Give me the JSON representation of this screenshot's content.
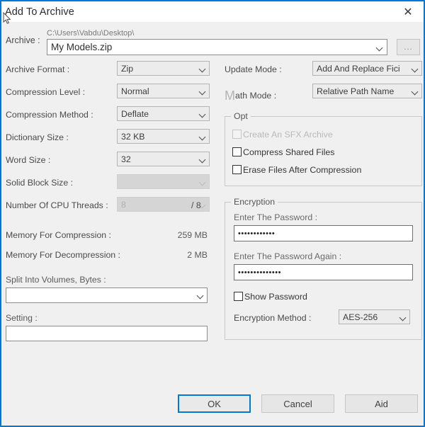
{
  "window": {
    "title": "Add To Archive",
    "close_icon": "close-icon",
    "accent_color": "#0078d7"
  },
  "archive": {
    "label": "Archive :",
    "path": "C:\\Users\\Vabdu\\Desktop\\",
    "value": "My Models.zip",
    "browse_label": "...",
    "chevron_icon": "chevron-down-icon"
  },
  "left": {
    "archive_format": {
      "label": "Archive Format :",
      "value": "Zip"
    },
    "compression_level": {
      "label": "Compression Level :",
      "value": "Normal"
    },
    "compression_method": {
      "label": "Compression Method :",
      "value": "Deflate"
    },
    "dictionary_size": {
      "label": "Dictionary Size :",
      "value": "32 KB"
    },
    "word_size": {
      "label": "Word Size :",
      "value": "32"
    },
    "solid_block_size": {
      "label": "Solid Block Size :",
      "value": ""
    },
    "cpu_threads": {
      "label": "Number Of CPU Threads :",
      "value": "8",
      "total": "/ 8"
    },
    "memory_compression": {
      "label": "Memory For Compression :",
      "value": "259 MB"
    },
    "memory_decompression": {
      "label": "Memory For Decompression :",
      "value": "2 MB"
    },
    "split_volumes": {
      "label": "Split Into Volumes, Bytes :",
      "value": ""
    },
    "setting": {
      "label": "Setting :",
      "value": ""
    }
  },
  "right": {
    "update_mode": {
      "label": "Update Mode :",
      "value": "Add And Replace Fici"
    },
    "path_mode": {
      "label_cap": "M",
      "label_rest": "ath Mode :",
      "value": "Relative Path Name"
    },
    "options": {
      "title": "Opt",
      "items": [
        {
          "label": "Create An SFX Archive",
          "checked": false,
          "disabled": true
        },
        {
          "label": "Compress Shared Files",
          "checked": false,
          "disabled": false
        },
        {
          "label": "Erase Files After Compression",
          "checked": false,
          "disabled": false
        }
      ]
    },
    "encryption": {
      "title": "Encryption",
      "password_label": "Enter The Password :",
      "password_value": "••••••••••••",
      "password_again_label": "Enter The Password Again :",
      "password_again_value": "••••••••••••••",
      "show_password_label": "Show Password",
      "show_password_checked": false,
      "method_label": "Encryption Method :",
      "method_value": "AES-256"
    }
  },
  "buttons": {
    "ok": "OK",
    "cancel": "Cancel",
    "help": "Aid"
  }
}
